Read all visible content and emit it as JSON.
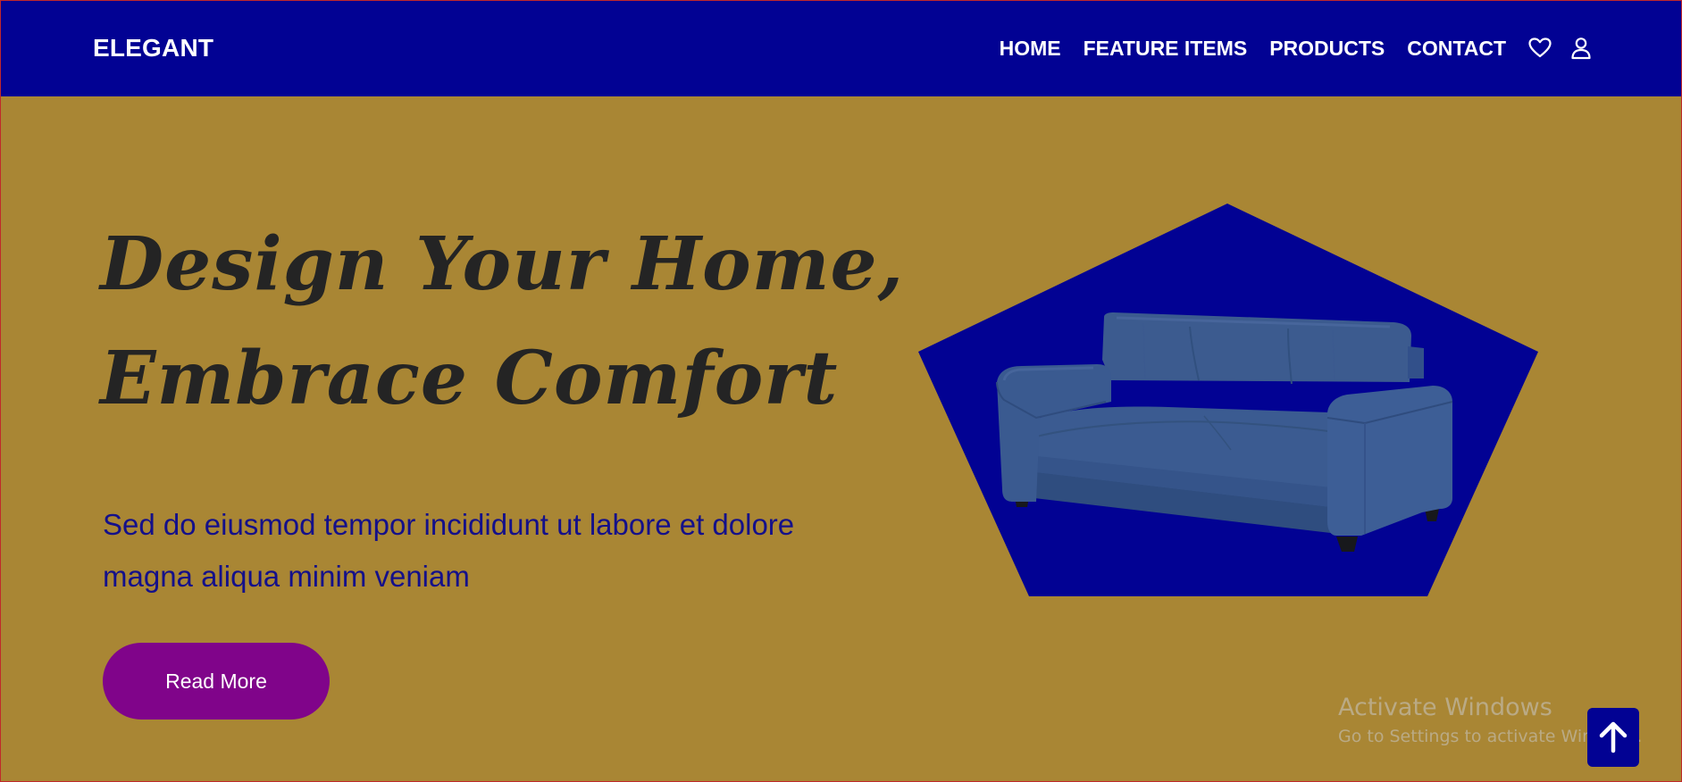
{
  "brand": {
    "name": "ELEGANT"
  },
  "nav": {
    "items": [
      {
        "label": "HOME"
      },
      {
        "label": "FEATURE ITEMS"
      },
      {
        "label": "PRODUCTS"
      },
      {
        "label": "CONTACT"
      }
    ],
    "icons": [
      "heart-icon",
      "user-icon"
    ]
  },
  "hero": {
    "title_line1": "Design Your Home,",
    "title_line2": "Embrace Comfort",
    "description": "Sed do eiusmod tempor incididunt ut labore et dolore magna aliqua minim veniam",
    "cta_label": "Read More",
    "image": "sofa-image"
  },
  "watermark": {
    "title": "Activate Windows",
    "subtitle": "Go to Settings to activate Windows."
  },
  "scroll_top": {
    "icon": "arrow-up-icon"
  },
  "colors": {
    "header_bg": "#020293",
    "page_bg": "#a98634",
    "title_text": "#242424",
    "description_text": "#14108a",
    "button_bg": "#80048a",
    "pentagon_bg": "#020293",
    "sofa": "#3d5a8a"
  }
}
